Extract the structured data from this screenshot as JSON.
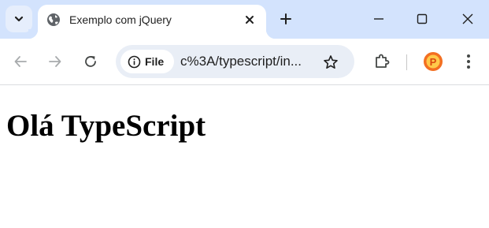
{
  "colors": {
    "tabstrip_bg": "#d3e3fd",
    "omnibox_bg": "#e9eef6",
    "icon": "#444746",
    "icon_disabled": "#a8abad",
    "avatar_orange": "#f36f21"
  },
  "tab": {
    "title": "Exemplo com jQuery",
    "favicon": "globe-icon"
  },
  "tabstrip": {
    "search_icon": "chevron-down-icon",
    "new_tab_icon": "plus-icon",
    "window_controls": [
      "minimize-icon",
      "maximize-icon",
      "close-icon"
    ]
  },
  "toolbar": {
    "back_icon": "back-arrow-icon",
    "forward_icon": "forward-arrow-icon",
    "reload_icon": "reload-icon",
    "site_info_label": "File",
    "url": "c%3A/typescript/in...",
    "bookmark_icon": "star-icon",
    "extensions_icon": "puzzle-icon",
    "menu_icon": "kebab-menu-icon",
    "profile_initial": "P"
  },
  "page": {
    "heading": "Olá TypeScript"
  }
}
